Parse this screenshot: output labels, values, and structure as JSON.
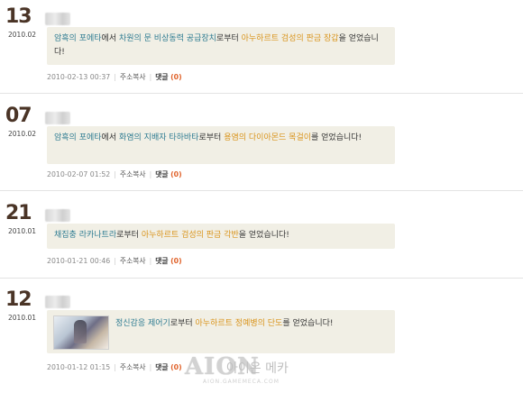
{
  "entries": [
    {
      "day": "13",
      "ym": "2010.02",
      "segments": [
        {
          "t": "암흑의 포에타",
          "c": "blue"
        },
        {
          "t": "에서 ",
          "c": ""
        },
        {
          "t": "차원의 문 비상동력 공급장치",
          "c": "blue"
        },
        {
          "t": "로부터 ",
          "c": ""
        },
        {
          "t": "아누하르트 검성의 판금 장갑",
          "c": "orange"
        },
        {
          "t": "을 얻었습니다!",
          "c": ""
        }
      ],
      "date": "2010-02-13 00:37",
      "copy": "주소복사",
      "comments": "댓글",
      "count": "(0)"
    },
    {
      "day": "07",
      "ym": "2010.02",
      "segments": [
        {
          "t": "암흑의 포에타",
          "c": "blue"
        },
        {
          "t": "에서 ",
          "c": ""
        },
        {
          "t": "화염의 지배자 타하바타",
          "c": "blue"
        },
        {
          "t": "로부터 ",
          "c": ""
        },
        {
          "t": "용염의 다이아몬드 목걸이",
          "c": "orange"
        },
        {
          "t": "를 얻었습니다!",
          "c": ""
        }
      ],
      "date": "2010-02-07 01:52",
      "copy": "주소복사",
      "comments": "댓글",
      "count": "(0)"
    },
    {
      "day": "21",
      "ym": "2010.01",
      "segments": [
        {
          "t": "채집충 라카나트라",
          "c": "blue"
        },
        {
          "t": "로부터 ",
          "c": ""
        },
        {
          "t": "아누하르트 검성의 판금 각반",
          "c": "orange"
        },
        {
          "t": "을 얻었습니다!",
          "c": ""
        }
      ],
      "date": "2010-01-21 00:46",
      "copy": "주소복사",
      "comments": "댓글",
      "count": "(0)"
    },
    {
      "day": "12",
      "ym": "2010.01",
      "segments": [
        {
          "t": "정신감응 제어기",
          "c": "blue"
        },
        {
          "t": "로부터 ",
          "c": ""
        },
        {
          "t": "아누하르트 정예병의 단도",
          "c": "orange"
        },
        {
          "t": "를 얻었습니다!",
          "c": ""
        }
      ],
      "date": "2010-01-12 01:15",
      "copy": "주소복사",
      "comments": "댓글",
      "count": "(0)"
    }
  ],
  "watermark": {
    "logo": "AION",
    "kr": "아이온 메카",
    "url": "AION.GAMEMECA.COM"
  },
  "colors": {
    "blue": "#2f7c92",
    "orange": "#d9941c",
    "count": "#e0622a",
    "box": "#f1efe5"
  }
}
